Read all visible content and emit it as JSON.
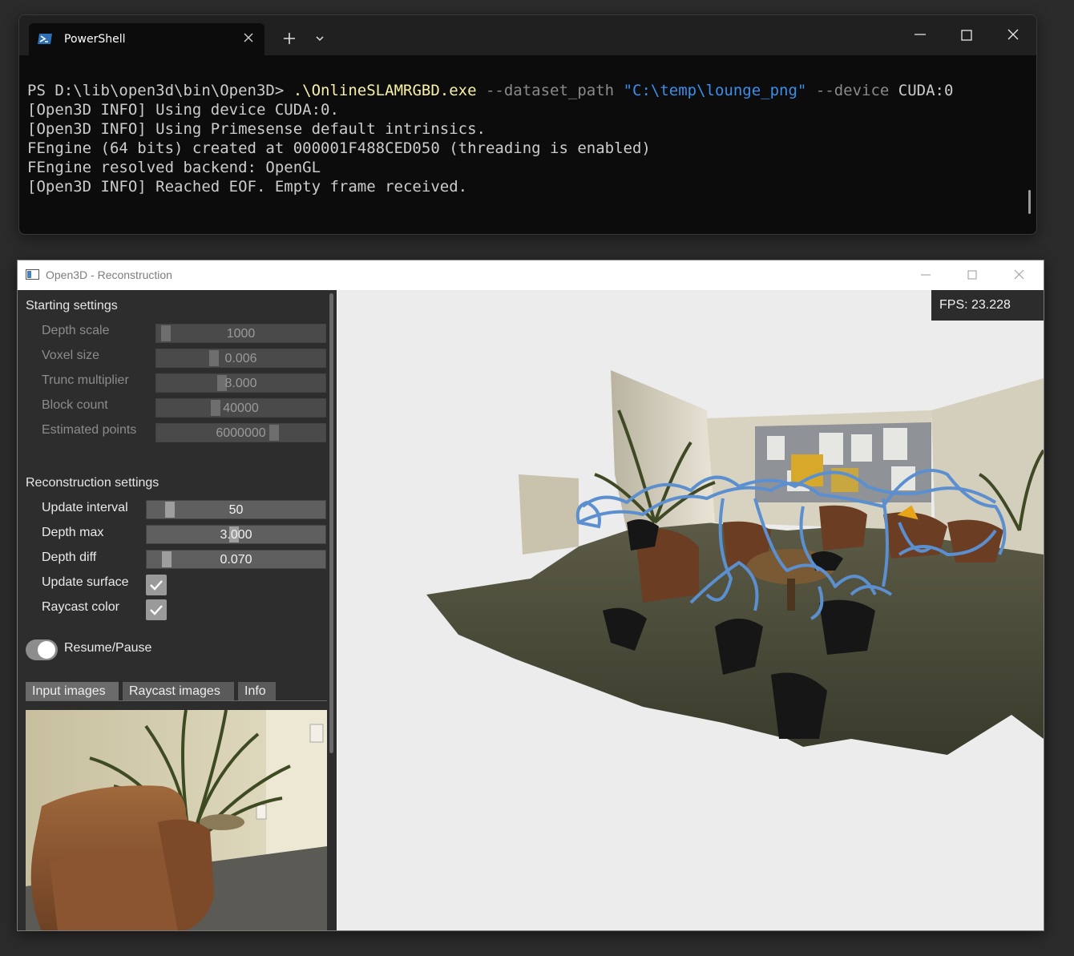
{
  "powershell": {
    "tab_title": "PowerShell",
    "tab_icon": "powershell-icon",
    "new_tab_icon": "plus-icon",
    "dropdown_icon": "chevron-down-icon",
    "window_buttons": [
      "minimize-icon",
      "maximize-icon",
      "close-icon"
    ],
    "terminal": {
      "prompt": "PS D:\\lib\\open3d\\bin\\Open3D> ",
      "exe": ".\\OnlineSLAMRGBD.exe",
      "flag1": "--dataset_path",
      "path_arg": "\"C:\\temp\\lounge_png\"",
      "flag2": "--device",
      "device_arg": "CUDA:0",
      "lines": [
        "[Open3D INFO] Using device CUDA:0.",
        "[Open3D INFO] Using Primesense default intrinsics.",
        "FEngine (64 bits) created at 000001F488CED050 (threading is enabled)",
        "FEngine resolved backend: OpenGL",
        "[Open3D INFO] Reached EOF. Empty frame received."
      ]
    },
    "colors": {
      "background": "#0c0c0c",
      "executable": "#f9f1a5",
      "string": "#3b8eea",
      "flag": "#8a8a8a"
    }
  },
  "open3d": {
    "window_title": "Open3D - Reconstruction",
    "starting_settings": {
      "heading": "Starting settings",
      "items": [
        {
          "label": "Depth scale",
          "value": "1000",
          "level": 0.03
        },
        {
          "label": "Voxel size",
          "value": "0.006",
          "level": 0.33
        },
        {
          "label": "Trunc multiplier",
          "value": "8.000",
          "level": 0.38
        },
        {
          "label": "Block count",
          "value": "40000",
          "level": 0.34
        },
        {
          "label": "Estimated points",
          "value": "6000000",
          "level": 0.71
        }
      ]
    },
    "reconstruction_settings": {
      "heading": "Reconstruction settings",
      "sliders": [
        {
          "label": "Update interval",
          "value": "50",
          "level": 0.11
        },
        {
          "label": "Depth max",
          "value": "3.000",
          "level": 0.49
        },
        {
          "label": "Depth diff",
          "value": "0.070",
          "level": 0.09
        }
      ],
      "checkboxes": [
        {
          "label": "Update surface",
          "checked": true
        },
        {
          "label": "Raycast color",
          "checked": true
        }
      ]
    },
    "toggle": {
      "label": "Resume/Pause",
      "on": true
    },
    "tabs": [
      "Input images",
      "Raycast images",
      "Info"
    ],
    "fps": "FPS: 23.228",
    "colors": {
      "panel": "#2d2d2d",
      "viewport": "#ececec",
      "trajectory": "#5b8fcf",
      "current_pose": "#e8a317"
    }
  }
}
